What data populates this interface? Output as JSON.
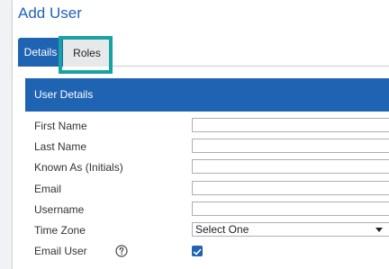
{
  "page": {
    "title": "Add User"
  },
  "tabs": [
    {
      "label": "Details",
      "active": true
    },
    {
      "label": "Roles",
      "active": false
    }
  ],
  "colors": {
    "accent": "#1f63b3",
    "highlight": "#17a3a3"
  },
  "section": {
    "header": "User Details",
    "fields": {
      "first_name": {
        "label": "First Name",
        "value": ""
      },
      "last_name": {
        "label": "Last Name",
        "value": ""
      },
      "known_as": {
        "label": "Known As (Initials)",
        "value": ""
      },
      "email": {
        "label": "Email",
        "value": ""
      },
      "username": {
        "label": "Username",
        "value": ""
      },
      "time_zone": {
        "label": "Time Zone",
        "value": "Select One"
      },
      "email_user": {
        "label": "Email User",
        "checked": true,
        "help_icon": "question-circle-icon"
      }
    }
  }
}
